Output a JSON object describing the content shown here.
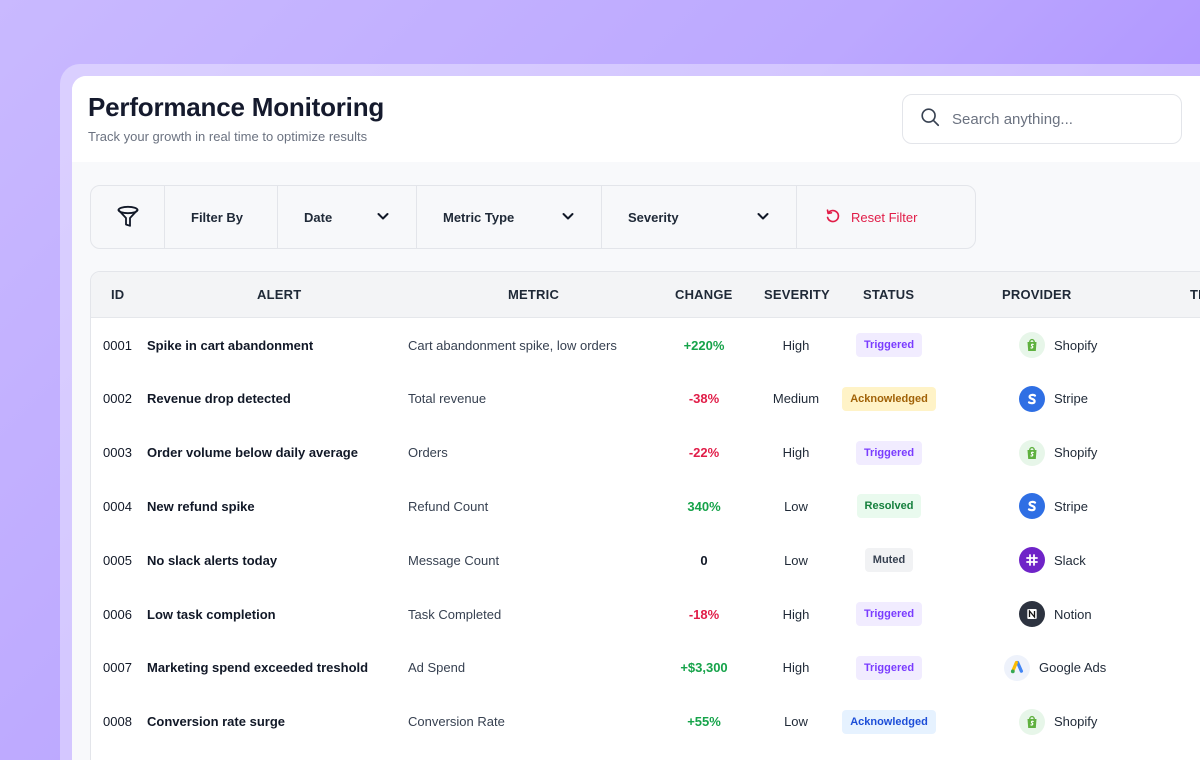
{
  "header": {
    "title": "Performance Monitoring",
    "subtitle": "Track your growth in real time to optimize results"
  },
  "search": {
    "placeholder": "Search anything...",
    "icon": "search-icon"
  },
  "filter_bar": {
    "icon": "funnel-icon",
    "label": "Filter By",
    "date_label": "Date",
    "metric_type_label": "Metric Type",
    "severity_label": "Severity",
    "reset_label": "Reset Filter",
    "reset_color": "#e11d48"
  },
  "table": {
    "columns": [
      "ID",
      "ALERT",
      "METRIC",
      "CHANGE",
      "SEVERITY",
      "STATUS",
      "PROVIDER",
      "TI"
    ],
    "rows": [
      {
        "id": "0001",
        "alert": "Spike in cart abandonment",
        "metric": "Cart abandonment spike, low orders",
        "change": "+220%",
        "change_kind": "pos",
        "severity": "High",
        "status": "Triggered",
        "status_kind": "triggered",
        "provider": "Shopify",
        "provider_icon": "shopify-icon"
      },
      {
        "id": "0002",
        "alert": "Revenue drop detected",
        "metric": "Total revenue",
        "change": "-38%",
        "change_kind": "neg",
        "severity": "Medium",
        "status": "Acknowledged",
        "status_kind": "ack-y",
        "provider": "Stripe",
        "provider_icon": "stripe-icon"
      },
      {
        "id": "0003",
        "alert": "Order volume below daily average",
        "metric": "Orders",
        "change": "-22%",
        "change_kind": "neg",
        "severity": "High",
        "status": "Triggered",
        "status_kind": "triggered",
        "provider": "Shopify",
        "provider_icon": "shopify-icon"
      },
      {
        "id": "0004",
        "alert": "New refund spike",
        "metric": "Refund Count",
        "change": "340%",
        "change_kind": "pos",
        "severity": "Low",
        "status": "Resolved",
        "status_kind": "resolved",
        "provider": "Stripe",
        "provider_icon": "stripe-icon"
      },
      {
        "id": "0005",
        "alert": "No slack alerts today",
        "metric": "Message Count",
        "change": "0",
        "change_kind": "neu",
        "severity": "Low",
        "status": "Muted",
        "status_kind": "muted",
        "provider": "Slack",
        "provider_icon": "slack-icon"
      },
      {
        "id": "0006",
        "alert": "Low task completion",
        "metric": "Task Completed",
        "change": "-18%",
        "change_kind": "neg",
        "severity": "High",
        "status": "Triggered",
        "status_kind": "triggered",
        "provider": "Notion",
        "provider_icon": "notion-icon"
      },
      {
        "id": "0007",
        "alert": "Marketing spend exceeded treshold",
        "metric": "Ad Spend",
        "change": "+$3,300",
        "change_kind": "pos",
        "severity": "High",
        "status": "Triggered",
        "status_kind": "triggered",
        "provider": "Google Ads",
        "provider_icon": "google-ads-icon"
      },
      {
        "id": "0008",
        "alert": "Conversion rate surge",
        "metric": "Conversion Rate",
        "change": "+55%",
        "change_kind": "pos",
        "severity": "Low",
        "status": "Acknowledged",
        "status_kind": "ack-b",
        "provider": "Shopify",
        "provider_icon": "shopify-icon"
      }
    ]
  },
  "colors": {
    "positive": "#16a34a",
    "negative": "#e11d48",
    "triggered": "#7a3cff",
    "background_gradient_end": "#9f7cff"
  }
}
